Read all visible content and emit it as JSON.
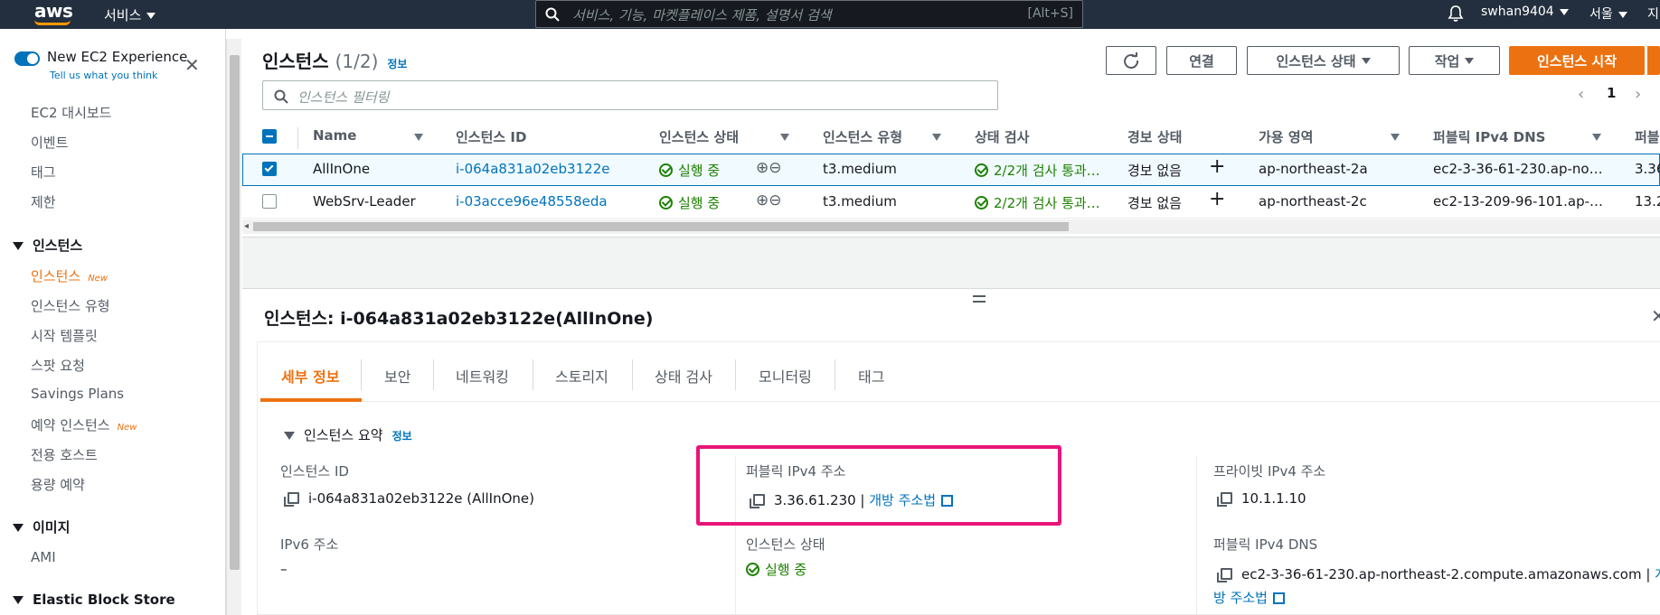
{
  "topbar": {
    "logo": "aws",
    "services_label": "서비스",
    "search_placeholder": "서비스, 기능, 마켓플레이스 제품, 설명서 검색",
    "search_shortcut": "[Alt+S]",
    "username": "swhan9404",
    "region": "서울",
    "extra": "지"
  },
  "sidebar": {
    "new_experience": "New EC2 Experience",
    "tell_us": "Tell us what you think",
    "items": [
      {
        "label": "EC2 대시보드"
      },
      {
        "label": "이벤트"
      },
      {
        "label": "태그"
      },
      {
        "label": "제한"
      }
    ],
    "section_instances": "인스턴스",
    "instances_items": [
      {
        "label": "인스턴스",
        "badge": "New"
      },
      {
        "label": "인스턴스 유형"
      },
      {
        "label": "시작 템플릿"
      },
      {
        "label": "스팟 요청"
      },
      {
        "label": "Savings Plans"
      },
      {
        "label": "예약 인스턴스",
        "badge": "New"
      },
      {
        "label": "전용 호스트"
      },
      {
        "label": "용량 예약"
      }
    ],
    "section_images": "이미지",
    "images_items": [
      {
        "label": "AMI"
      }
    ],
    "section_ebs": "Elastic Block Store"
  },
  "header": {
    "title": "인스턴스",
    "count": "(1/2)",
    "info": "정보",
    "connect": "연결",
    "instance_state": "인스턴스 상태",
    "actions": "작업",
    "launch": "인스턴스 시작",
    "filter_placeholder": "인스턴스 필터링",
    "page": "1"
  },
  "table": {
    "columns": [
      "Name",
      "인스턴스 ID",
      "인스턴스 상태",
      "인스턴스 유형",
      "상태 검사",
      "경보 상태",
      "가용 영역",
      "퍼블릭 IPv4 DNS",
      "퍼블"
    ],
    "rows": [
      {
        "name": "AllInOne",
        "id": "i-064a831a02eb3122e",
        "state": "실행 중",
        "type": "t3.medium",
        "check": "2/2개 검사 통과…",
        "alarm": "경보 없음",
        "az": "ap-northeast-2a",
        "dns": "ec2-3-36-61-230.ap-no…",
        "ip": "3.36",
        "selected": true
      },
      {
        "name": "WebSrv-Leader",
        "id": "i-03acce96e48558eda",
        "state": "실행 중",
        "type": "t3.medium",
        "check": "2/2개 검사 통과…",
        "alarm": "경보 없음",
        "az": "ap-northeast-2c",
        "dns": "ec2-13-209-96-101.ap-…",
        "ip": "13.2",
        "selected": false
      }
    ]
  },
  "detail": {
    "title": "인스턴스: i-064a831a02eb3122e(AllInOne)",
    "tabs": [
      "세부 정보",
      "보안",
      "네트워킹",
      "스토리지",
      "상태 검사",
      "모니터링",
      "태그"
    ],
    "summary_label": "인스턴스 요약",
    "summary_info": "정보",
    "instance_id_label": "인스턴스 ID",
    "instance_id_value": "i-064a831a02eb3122e (AllInOne)",
    "public_ip_label": "퍼블릭 IPv4 주소",
    "public_ip_value": "3.36.61.230",
    "open_address": "개방 주소법",
    "private_ip_label": "프라이빗 IPv4 주소",
    "private_ip_value": "10.1.1.10",
    "ipv6_label": "IPv6 주소",
    "ipv6_value": "–",
    "state_label": "인스턴스 상태",
    "state_value": "실행 중",
    "public_dns_label": "퍼블릭 IPv4 DNS",
    "public_dns_value": "ec2-3-36-61-230.ap-northeast-2.compute.amazonaws.com",
    "open_address_2a": "개",
    "open_address_2b": "방 주소법"
  },
  "colors": {
    "accent": "#ec7211",
    "link": "#0073bb",
    "success": "#1d8102",
    "highlight": "#e8157a",
    "topbar": "#232f3e"
  }
}
